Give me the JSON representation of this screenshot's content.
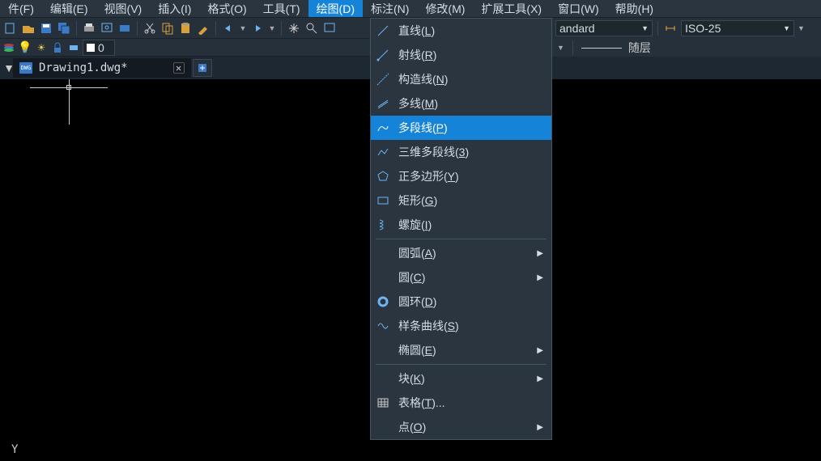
{
  "menubar": {
    "items": [
      {
        "label": "件(F)"
      },
      {
        "label": "编辑(E)"
      },
      {
        "label": "视图(V)"
      },
      {
        "label": "插入(I)"
      },
      {
        "label": "格式(O)"
      },
      {
        "label": "工具(T)"
      },
      {
        "label": "绘图(D)",
        "active": true
      },
      {
        "label": "标注(N)"
      },
      {
        "label": "修改(M)"
      },
      {
        "label": "扩展工具(X)"
      },
      {
        "label": "窗口(W)"
      },
      {
        "label": "帮助(H)"
      }
    ]
  },
  "toolbar2": {
    "layer_state": "0"
  },
  "style_dropdowns": {
    "text_style": "andard",
    "dim_style": "ISO-25",
    "line_label": "随层"
  },
  "tabs": {
    "active_name": "Drawing1.dwg*"
  },
  "draw_menu": {
    "items": [
      {
        "icon": "line-icon",
        "label_plain_prefix": "直线(",
        "u": "L",
        "label_plain_suffix": ")"
      },
      {
        "icon": "ray-icon",
        "label_plain_prefix": "射线(",
        "u": "R",
        "label_plain_suffix": ")"
      },
      {
        "icon": "xline-icon",
        "label_plain_prefix": "构造线(",
        "u": "N",
        "label_plain_suffix": ")"
      },
      {
        "icon": "mline-icon",
        "label_plain_prefix": "多线(",
        "u": "M",
        "label_plain_suffix": ")"
      },
      {
        "icon": "pline-icon",
        "label_plain_prefix": "多段线(",
        "u": "P",
        "label_plain_suffix": ")",
        "highlight": true
      },
      {
        "icon": "3dpoly-icon",
        "label_plain_prefix": "三维多段线(",
        "u": "3",
        "label_plain_suffix": ")"
      },
      {
        "icon": "polygon-icon",
        "label_plain_prefix": "正多边形(",
        "u": "Y",
        "label_plain_suffix": ")"
      },
      {
        "icon": "rect-icon",
        "label_plain_prefix": "矩形(",
        "u": "G",
        "label_plain_suffix": ")"
      },
      {
        "icon": "helix-icon",
        "label_plain_prefix": "螺旋(",
        "u": "I",
        "label_plain_suffix": ")"
      },
      {
        "sep": true
      },
      {
        "icon": "",
        "label_plain_prefix": "圆弧(",
        "u": "A",
        "label_plain_suffix": ")",
        "sub": true
      },
      {
        "icon": "",
        "label_plain_prefix": "圆(",
        "u": "C",
        "label_plain_suffix": ")",
        "sub": true
      },
      {
        "icon": "donut-icon",
        "label_plain_prefix": "圆环(",
        "u": "D",
        "label_plain_suffix": ")"
      },
      {
        "icon": "spline-icon",
        "label_plain_prefix": "样条曲线(",
        "u": "S",
        "label_plain_suffix": ")"
      },
      {
        "icon": "",
        "label_plain_prefix": "椭圆(",
        "u": "E",
        "label_plain_suffix": ")",
        "sub": true
      },
      {
        "sep": true
      },
      {
        "icon": "",
        "label_plain_prefix": "块(",
        "u": "K",
        "label_plain_suffix": ")",
        "sub": true
      },
      {
        "icon": "table-icon",
        "label_plain_prefix": "表格(",
        "u": "T",
        "label_plain_suffix": ")..."
      },
      {
        "icon": "",
        "label_plain_prefix": "点(",
        "u": "O",
        "label_plain_suffix": ")",
        "sub": true
      }
    ]
  },
  "ucs": {
    "label": "Y"
  }
}
